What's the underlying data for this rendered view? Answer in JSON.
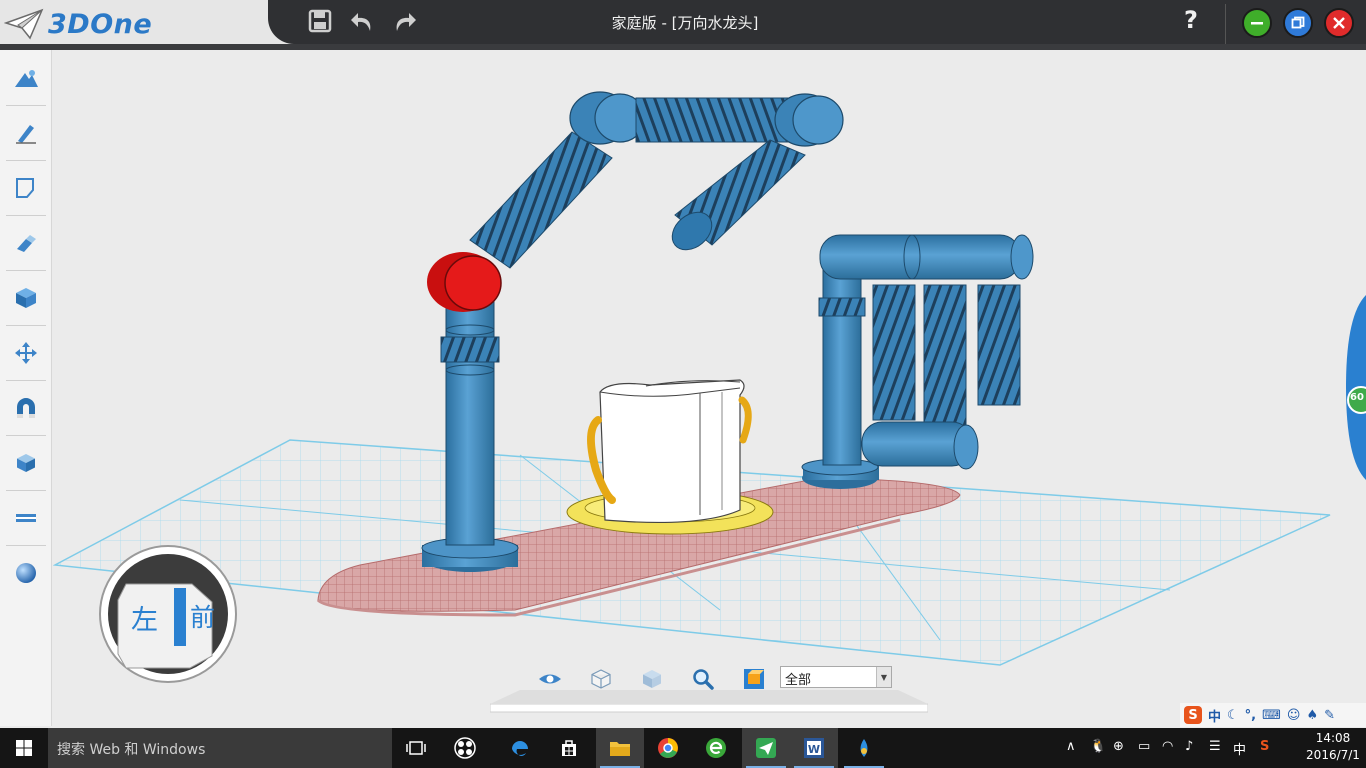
{
  "app": {
    "logo_text": "3DOne",
    "window_title": "家庭版 - [万向水龙头]",
    "help_label": "?"
  },
  "quick_access": [
    {
      "name": "save-icon"
    },
    {
      "name": "undo-icon"
    },
    {
      "name": "redo-icon"
    }
  ],
  "window_controls": {
    "minimize_color": "#3fae2a",
    "restore_color": "#2f7ad8",
    "close_color": "#e02b2b"
  },
  "left_toolbar": [
    {
      "name": "basic-solid-icon"
    },
    {
      "name": "sketch-pencil-icon"
    },
    {
      "name": "sketch-edit-icon"
    },
    {
      "name": "feature-eraser-icon"
    },
    {
      "name": "special-feature-cube-icon"
    },
    {
      "name": "move-arrows-icon"
    },
    {
      "name": "magnet-icon"
    },
    {
      "name": "combine-cube-icon"
    },
    {
      "name": "distance-ruler-icon"
    },
    {
      "name": "material-sphere-icon"
    }
  ],
  "view_cube": {
    "left_label": "左",
    "front_label": "前"
  },
  "bottom_toolbar": {
    "tools": [
      {
        "name": "view-eye-icon"
      },
      {
        "name": "wireframe-cube-icon"
      },
      {
        "name": "shaded-cube-icon"
      },
      {
        "name": "zoom-magnifier-icon"
      },
      {
        "name": "render-box-icon"
      }
    ],
    "filter_value": "全部"
  },
  "right_tab": {
    "fps": "60"
  },
  "ime": {
    "brand": "S",
    "mode": "中"
  },
  "taskbar": {
    "search_placeholder": "搜索 Web 和 Windows",
    "apps": [
      {
        "name": "task-view-icon"
      },
      {
        "name": "pinwheel-app-icon"
      },
      {
        "name": "edge-browser-icon"
      },
      {
        "name": "store-icon"
      },
      {
        "name": "file-explorer-icon"
      },
      {
        "name": "chrome-like-browser-icon"
      },
      {
        "name": "green-e-browser-icon"
      },
      {
        "name": "3done-app-icon"
      },
      {
        "name": "word-icon"
      },
      {
        "name": "printer-app-icon"
      }
    ],
    "tray_lang": "中",
    "time": "14:08",
    "date": "2016/7/1"
  },
  "colors": {
    "model_blue": "#3d84b8",
    "joint_red": "#e01515",
    "grid_line": "#8ed3ec",
    "base_pad": "#d99a9a",
    "cup_handle": "#f0b820"
  }
}
